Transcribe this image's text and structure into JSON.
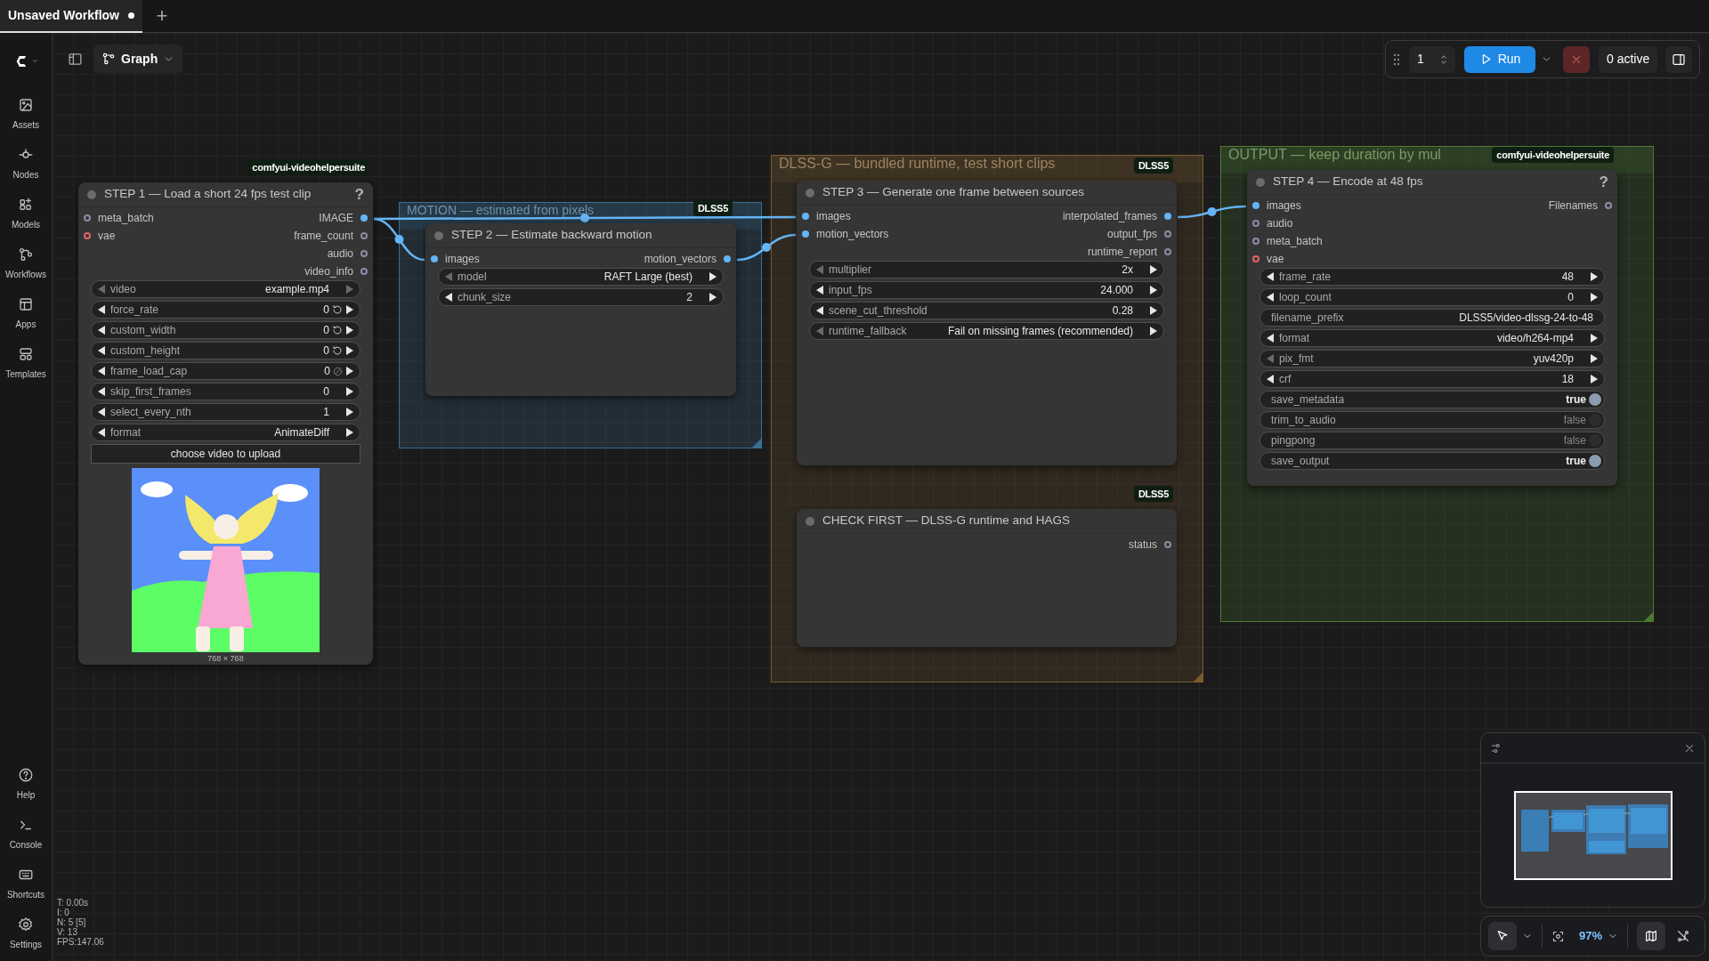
{
  "tabs": [
    {
      "label": "Unsaved Workflow",
      "unsaved": true,
      "selected": true
    }
  ],
  "new_tab": "+",
  "sidebar": {
    "top": [
      {
        "kind": "assets",
        "label": "Assets"
      },
      {
        "kind": "nodes",
        "label": "Nodes"
      },
      {
        "kind": "models",
        "label": "Models"
      },
      {
        "kind": "workflows",
        "label": "Workflows"
      },
      {
        "kind": "apps",
        "label": "Apps"
      },
      {
        "kind": "templates",
        "label": "Templates"
      }
    ],
    "bottom": [
      {
        "kind": "help",
        "label": "Help"
      },
      {
        "kind": "console",
        "label": "Console"
      },
      {
        "kind": "shortcuts",
        "label": "Shortcuts"
      },
      {
        "kind": "settings",
        "label": "Settings"
      }
    ]
  },
  "view_switch": "Graph",
  "queue": {
    "batch_count": "1",
    "run": "Run",
    "active": "0 active"
  },
  "groups": [
    {
      "title": "MOTION — estimated from pixels",
      "color": "#3a6e93"
    },
    {
      "title": "DLSS-G — bundled runtime, test short clips",
      "color": "#7a5c2e"
    },
    {
      "title": "OUTPUT — keep duration by mul",
      "color": "#4b7a33"
    }
  ],
  "nodes": [
    {
      "title": "STEP 1 — Load a short 24 fps test clip",
      "help": "?",
      "badge": "comfyui-videohelpersuite",
      "inputs": [
        {
          "label": "meta_batch",
          "color": "#8c8ca6",
          "connected": false
        },
        {
          "label": "vae",
          "color": "#e06666",
          "connected": false
        }
      ],
      "outputs": [
        {
          "label": "IMAGE",
          "color": "#64b5f6",
          "connected": true
        },
        {
          "label": "frame_count",
          "color": "#8c8ca6",
          "connected": false
        },
        {
          "label": "audio",
          "color": "#8c8ca6",
          "connected": false
        },
        {
          "label": "video_info",
          "color": "#8c8ca6",
          "connected": false
        }
      ],
      "widgets": [
        {
          "kind": "combo",
          "label": "video",
          "value": "example.mp4",
          "prev_enabled": false,
          "next_enabled": false
        },
        {
          "kind": "number",
          "label": "force_rate",
          "value": "0",
          "prev_enabled": true,
          "next_enabled": true,
          "resettable": true
        },
        {
          "kind": "number",
          "label": "custom_width",
          "value": "0",
          "prev_enabled": true,
          "next_enabled": true,
          "resettable": true
        },
        {
          "kind": "number",
          "label": "custom_height",
          "value": "0",
          "prev_enabled": true,
          "next_enabled": true,
          "resettable": true
        },
        {
          "kind": "number",
          "label": "frame_load_cap",
          "value": "0",
          "prev_enabled": true,
          "next_enabled": true,
          "limit_off": true
        },
        {
          "kind": "number",
          "label": "skip_first_frames",
          "value": "0",
          "prev_enabled": true,
          "next_enabled": true
        },
        {
          "kind": "number",
          "label": "select_every_nth",
          "value": "1",
          "prev_enabled": true,
          "next_enabled": true
        },
        {
          "kind": "combo",
          "label": "format",
          "value": "AnimateDiff",
          "prev_enabled": true,
          "next_enabled": true
        }
      ],
      "upload": "choose video to upload",
      "preview": {
        "kind": "picture",
        "caption": "768 × 768"
      }
    },
    {
      "title": "STEP 2 — Estimate backward motion",
      "badge": "DLSS5",
      "inputs": [
        {
          "label": "images",
          "color": "#64b5f6",
          "connected": true
        }
      ],
      "outputs": [
        {
          "label": "motion_vectors",
          "color": "#64b5f6",
          "connected": true
        }
      ],
      "widgets": [
        {
          "kind": "combo",
          "label": "model",
          "value": "RAFT Large (best)",
          "prev_enabled": false,
          "next_enabled": true
        },
        {
          "kind": "number",
          "label": "chunk_size",
          "value": "2",
          "prev_enabled": true,
          "next_enabled": true
        }
      ]
    },
    {
      "title": "STEP 3 — Generate one frame between sources",
      "badge": "DLSS5",
      "inputs": [
        {
          "label": "images",
          "color": "#64b5f6",
          "connected": true
        },
        {
          "label": "motion_vectors",
          "color": "#64b5f6",
          "connected": true
        }
      ],
      "outputs": [
        {
          "label": "interpolated_frames",
          "color": "#64b5f6",
          "connected": true
        },
        {
          "label": "output_fps",
          "color": "#8c8ca6",
          "connected": false
        },
        {
          "label": "runtime_report",
          "color": "#8c8ca6",
          "connected": false
        }
      ],
      "widgets": [
        {
          "kind": "combo",
          "label": "multiplier",
          "value": "2x",
          "prev_enabled": false,
          "next_enabled": true
        },
        {
          "kind": "number",
          "label": "input_fps",
          "value": "24.000",
          "prev_enabled": true,
          "next_enabled": true
        },
        {
          "kind": "number",
          "label": "scene_cut_threshold",
          "value": "0.28",
          "prev_enabled": true,
          "next_enabled": true
        },
        {
          "kind": "combo",
          "label": "runtime_fallback",
          "value": "Fail on missing frames (recommended)",
          "prev_enabled": false,
          "next_enabled": true
        }
      ]
    },
    {
      "title": "CHECK FIRST — DLSS-G runtime and HAGS",
      "badge": "DLSS5",
      "outputs": [
        {
          "label": "status",
          "color": "#8c8ca6",
          "connected": false
        }
      ]
    },
    {
      "title": "STEP 4 — Encode at 48 fps",
      "help": "?",
      "badge": "comfyui-videohelpersuite",
      "inputs": [
        {
          "label": "images",
          "color": "#64b5f6",
          "connected": true
        },
        {
          "label": "audio",
          "color": "#8c8ca6",
          "connected": false
        },
        {
          "label": "meta_batch",
          "color": "#8c8ca6",
          "connected": false
        },
        {
          "label": "vae",
          "color": "#e06666",
          "connected": false
        }
      ],
      "outputs": [
        {
          "label": "Filenames",
          "color": "#8c8ca6",
          "connected": false
        }
      ],
      "widgets": [
        {
          "kind": "number",
          "label": "frame_rate",
          "value": "48",
          "prev_enabled": true,
          "next_enabled": true
        },
        {
          "kind": "number",
          "label": "loop_count",
          "value": "0",
          "prev_enabled": true,
          "next_enabled": true
        },
        {
          "kind": "text",
          "label": "filename_prefix",
          "value": "DLSS5/video-dlssg-24-to-48"
        },
        {
          "kind": "combo",
          "label": "format",
          "value": "video/h264-mp4",
          "prev_enabled": true,
          "next_enabled": true
        },
        {
          "kind": "combo",
          "label": "pix_fmt",
          "value": "yuv420p",
          "prev_enabled": false,
          "next_enabled": true
        },
        {
          "kind": "number",
          "label": "crf",
          "value": "18",
          "prev_enabled": true,
          "next_enabled": true
        },
        {
          "kind": "toggle",
          "label": "save_metadata",
          "value": "true",
          "on": true
        },
        {
          "kind": "toggle",
          "label": "trim_to_audio",
          "value": "false",
          "on": false
        },
        {
          "kind": "toggle",
          "label": "pingpong",
          "value": "false",
          "on": false
        },
        {
          "kind": "toggle",
          "label": "save_output",
          "value": "true",
          "on": true
        }
      ]
    }
  ],
  "stats": [
    "T: 0.00s",
    "I: 0",
    "N: 5 [5]",
    "V: 13",
    "FPS:147.06"
  ],
  "canvas_controls": {
    "pointer_selected": true,
    "zoom": "97%",
    "minimap_shown": true
  }
}
